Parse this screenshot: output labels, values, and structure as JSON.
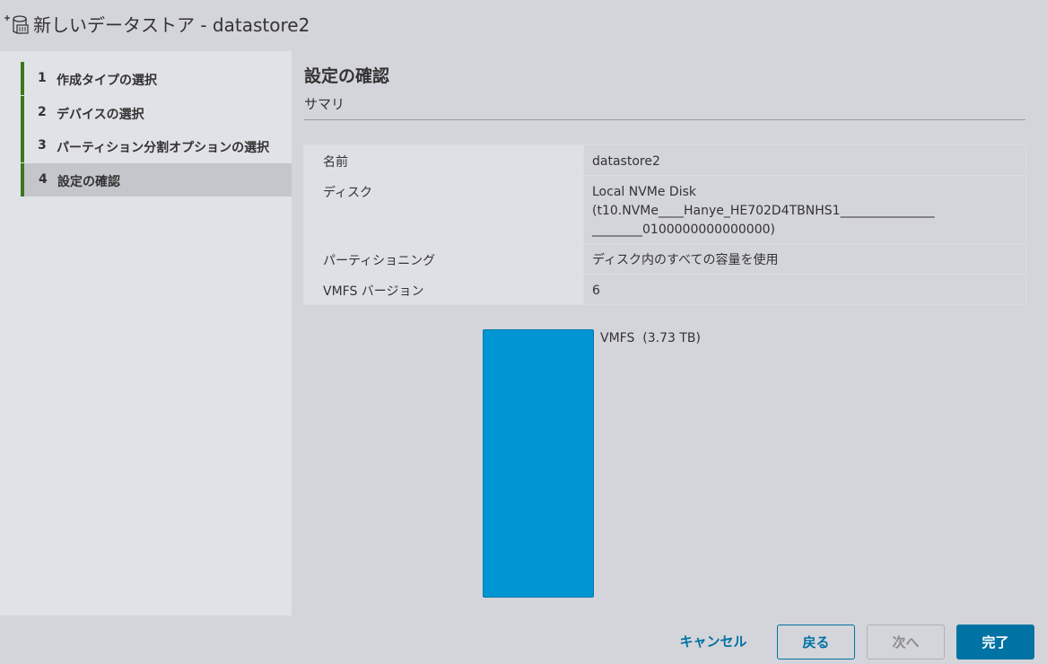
{
  "window": {
    "title": "新しいデータストア - datastore2",
    "icon": "new-datastore-icon"
  },
  "wizard": {
    "steps": [
      {
        "num": "1",
        "label": "作成タイプの選択"
      },
      {
        "num": "2",
        "label": "デバイスの選択"
      },
      {
        "num": "3",
        "label": "パーティション分割オプションの選択"
      },
      {
        "num": "4",
        "label": "設定の確認",
        "active": true
      }
    ]
  },
  "main": {
    "title": "設定の確認",
    "subtitle": "サマリ",
    "summary": {
      "name_key": "名前",
      "name_val": "datastore2",
      "disk_key": "ディスク",
      "disk_val_line1": "Local NVMe Disk",
      "disk_val_line2": "(t10.NVMe____Hanye_HE702D4TBNHS1_______________",
      "disk_val_line3": "________0100000000000000)",
      "partition_key": "パーティショニング",
      "partition_val": "ディスク内のすべての容量を使用",
      "vmfs_key": "VMFS バージョン",
      "vmfs_val": "6"
    },
    "partition_bar": {
      "label": "VMFS  (3.73 TB)",
      "fraction": 1.0,
      "color": "#0095d3"
    }
  },
  "footer": {
    "cancel": "キャンセル",
    "back": "戻る",
    "next": "次へ",
    "finish": "完了"
  },
  "colors": {
    "step_accent": "#3b7a19",
    "primary": "#0072a3"
  }
}
